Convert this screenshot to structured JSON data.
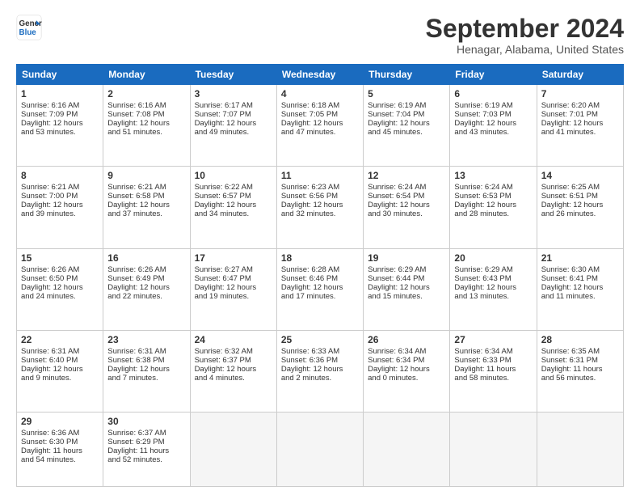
{
  "logo": {
    "line1": "General",
    "line2": "Blue"
  },
  "title": "September 2024",
  "subtitle": "Henagar, Alabama, United States",
  "headers": [
    "Sunday",
    "Monday",
    "Tuesday",
    "Wednesday",
    "Thursday",
    "Friday",
    "Saturday"
  ],
  "weeks": [
    [
      {
        "day": "1",
        "lines": [
          "Sunrise: 6:16 AM",
          "Sunset: 7:09 PM",
          "Daylight: 12 hours",
          "and 53 minutes."
        ]
      },
      {
        "day": "2",
        "lines": [
          "Sunrise: 6:16 AM",
          "Sunset: 7:08 PM",
          "Daylight: 12 hours",
          "and 51 minutes."
        ]
      },
      {
        "day": "3",
        "lines": [
          "Sunrise: 6:17 AM",
          "Sunset: 7:07 PM",
          "Daylight: 12 hours",
          "and 49 minutes."
        ]
      },
      {
        "day": "4",
        "lines": [
          "Sunrise: 6:18 AM",
          "Sunset: 7:05 PM",
          "Daylight: 12 hours",
          "and 47 minutes."
        ]
      },
      {
        "day": "5",
        "lines": [
          "Sunrise: 6:19 AM",
          "Sunset: 7:04 PM",
          "Daylight: 12 hours",
          "and 45 minutes."
        ]
      },
      {
        "day": "6",
        "lines": [
          "Sunrise: 6:19 AM",
          "Sunset: 7:03 PM",
          "Daylight: 12 hours",
          "and 43 minutes."
        ]
      },
      {
        "day": "7",
        "lines": [
          "Sunrise: 6:20 AM",
          "Sunset: 7:01 PM",
          "Daylight: 12 hours",
          "and 41 minutes."
        ]
      }
    ],
    [
      {
        "day": "8",
        "lines": [
          "Sunrise: 6:21 AM",
          "Sunset: 7:00 PM",
          "Daylight: 12 hours",
          "and 39 minutes."
        ]
      },
      {
        "day": "9",
        "lines": [
          "Sunrise: 6:21 AM",
          "Sunset: 6:58 PM",
          "Daylight: 12 hours",
          "and 37 minutes."
        ]
      },
      {
        "day": "10",
        "lines": [
          "Sunrise: 6:22 AM",
          "Sunset: 6:57 PM",
          "Daylight: 12 hours",
          "and 34 minutes."
        ]
      },
      {
        "day": "11",
        "lines": [
          "Sunrise: 6:23 AM",
          "Sunset: 6:56 PM",
          "Daylight: 12 hours",
          "and 32 minutes."
        ]
      },
      {
        "day": "12",
        "lines": [
          "Sunrise: 6:24 AM",
          "Sunset: 6:54 PM",
          "Daylight: 12 hours",
          "and 30 minutes."
        ]
      },
      {
        "day": "13",
        "lines": [
          "Sunrise: 6:24 AM",
          "Sunset: 6:53 PM",
          "Daylight: 12 hours",
          "and 28 minutes."
        ]
      },
      {
        "day": "14",
        "lines": [
          "Sunrise: 6:25 AM",
          "Sunset: 6:51 PM",
          "Daylight: 12 hours",
          "and 26 minutes."
        ]
      }
    ],
    [
      {
        "day": "15",
        "lines": [
          "Sunrise: 6:26 AM",
          "Sunset: 6:50 PM",
          "Daylight: 12 hours",
          "and 24 minutes."
        ]
      },
      {
        "day": "16",
        "lines": [
          "Sunrise: 6:26 AM",
          "Sunset: 6:49 PM",
          "Daylight: 12 hours",
          "and 22 minutes."
        ]
      },
      {
        "day": "17",
        "lines": [
          "Sunrise: 6:27 AM",
          "Sunset: 6:47 PM",
          "Daylight: 12 hours",
          "and 19 minutes."
        ]
      },
      {
        "day": "18",
        "lines": [
          "Sunrise: 6:28 AM",
          "Sunset: 6:46 PM",
          "Daylight: 12 hours",
          "and 17 minutes."
        ]
      },
      {
        "day": "19",
        "lines": [
          "Sunrise: 6:29 AM",
          "Sunset: 6:44 PM",
          "Daylight: 12 hours",
          "and 15 minutes."
        ]
      },
      {
        "day": "20",
        "lines": [
          "Sunrise: 6:29 AM",
          "Sunset: 6:43 PM",
          "Daylight: 12 hours",
          "and 13 minutes."
        ]
      },
      {
        "day": "21",
        "lines": [
          "Sunrise: 6:30 AM",
          "Sunset: 6:41 PM",
          "Daylight: 12 hours",
          "and 11 minutes."
        ]
      }
    ],
    [
      {
        "day": "22",
        "lines": [
          "Sunrise: 6:31 AM",
          "Sunset: 6:40 PM",
          "Daylight: 12 hours",
          "and 9 minutes."
        ]
      },
      {
        "day": "23",
        "lines": [
          "Sunrise: 6:31 AM",
          "Sunset: 6:38 PM",
          "Daylight: 12 hours",
          "and 7 minutes."
        ]
      },
      {
        "day": "24",
        "lines": [
          "Sunrise: 6:32 AM",
          "Sunset: 6:37 PM",
          "Daylight: 12 hours",
          "and 4 minutes."
        ]
      },
      {
        "day": "25",
        "lines": [
          "Sunrise: 6:33 AM",
          "Sunset: 6:36 PM",
          "Daylight: 12 hours",
          "and 2 minutes."
        ]
      },
      {
        "day": "26",
        "lines": [
          "Sunrise: 6:34 AM",
          "Sunset: 6:34 PM",
          "Daylight: 12 hours",
          "and 0 minutes."
        ]
      },
      {
        "day": "27",
        "lines": [
          "Sunrise: 6:34 AM",
          "Sunset: 6:33 PM",
          "Daylight: 11 hours",
          "and 58 minutes."
        ]
      },
      {
        "day": "28",
        "lines": [
          "Sunrise: 6:35 AM",
          "Sunset: 6:31 PM",
          "Daylight: 11 hours",
          "and 56 minutes."
        ]
      }
    ],
    [
      {
        "day": "29",
        "lines": [
          "Sunrise: 6:36 AM",
          "Sunset: 6:30 PM",
          "Daylight: 11 hours",
          "and 54 minutes."
        ]
      },
      {
        "day": "30",
        "lines": [
          "Sunrise: 6:37 AM",
          "Sunset: 6:29 PM",
          "Daylight: 11 hours",
          "and 52 minutes."
        ]
      },
      {
        "day": "",
        "lines": []
      },
      {
        "day": "",
        "lines": []
      },
      {
        "day": "",
        "lines": []
      },
      {
        "day": "",
        "lines": []
      },
      {
        "day": "",
        "lines": []
      }
    ]
  ]
}
